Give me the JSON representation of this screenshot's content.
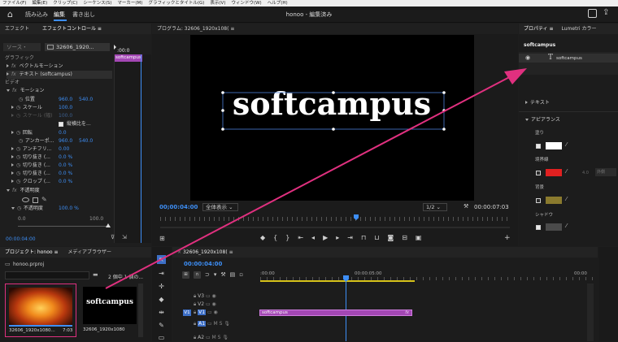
{
  "menu": [
    "ファイル(F)",
    "編集(E)",
    "クリップ(C)",
    "シーケンス(S)",
    "マーカー(M)",
    "グラフィックとタイトル(G)",
    "表示(V)",
    "ウィンドウ(W)",
    "ヘルプ(H)"
  ],
  "topbar": {
    "tabs": [
      "読み込み",
      "編集",
      "書き出し"
    ],
    "active_tab": "編集",
    "project_title": "honoo - 編集済み"
  },
  "effect_panel": {
    "tabs": [
      "エフェクト",
      "エフェクトコントロール ≡"
    ],
    "source_tab": "ソース・",
    "clip_tab": "32606_1920...",
    "clip_name": "softcampus",
    "timecode_start": ":00:0",
    "section_graphic": "グラフィック",
    "vector_motion": "ベクトルモーション",
    "text_item": "テキスト (softcampus)",
    "section_video": "ビデオ",
    "motion": "モーション",
    "props": [
      {
        "label": "位置",
        "v1": "960.0",
        "v2": "540.0"
      },
      {
        "label": "スケール",
        "v1": "100.0",
        "v2": ""
      },
      {
        "label": "スケール (幅)",
        "v1": "100.0",
        "v2": ""
      }
    ],
    "uniform_scale": "縦横比を...",
    "props2": [
      {
        "label": "回転",
        "v1": "0.0",
        "v2": ""
      },
      {
        "label": "アンカーポ...",
        "v1": "960.0",
        "v2": "540.0"
      },
      {
        "label": "アンチフリ...",
        "v1": "0.00",
        "v2": ""
      },
      {
        "label": "切り抜き (...",
        "v1": "0.0 %",
        "v2": ""
      },
      {
        "label": "切り抜き (...",
        "v1": "0.0 %",
        "v2": ""
      },
      {
        "label": "切り抜き (...",
        "v1": "0.0 %",
        "v2": ""
      },
      {
        "label": "クロップ (...",
        "v1": "0.0 %",
        "v2": ""
      }
    ],
    "opacity_section": "不透明度",
    "opacity_label": "不透明度",
    "opacity_value": "100.0 %",
    "slider_min": "0.0",
    "slider_max": "100.0",
    "timecode_bottom": "00:00:04:00"
  },
  "program": {
    "title": "プログラム: 32606_1920x108( ≡",
    "overlay_text": "softcampus",
    "timecode": "00;00:04:00",
    "fit": "全体表示",
    "quality": "1/2",
    "duration": "00:00:07:03"
  },
  "properties": {
    "tabs": [
      "プロパティ ≡",
      "Lumetri カラー"
    ],
    "clip_name": "softcampus",
    "layer_name": "softcampus",
    "text_section": "テキスト",
    "appearance_section": "アピアランス",
    "fill_label": "塗り",
    "stroke_label": "境界線",
    "stroke_width": "4.0",
    "stroke_mode": "外側",
    "background_label": "背景",
    "shadow_label": "シャドウ",
    "fill_color": "#ffffff",
    "stroke_color": "#e02020",
    "background_color": "#8a7a2e",
    "shadow_color": "#4a4a4a"
  },
  "project": {
    "tabs": [
      "プロジェクト: honoo ≡",
      "メディアブラウザー"
    ],
    "file": "honoo.prproj",
    "count": "2 個中 1 個の...",
    "items": [
      {
        "name": "32606_1920x1080...",
        "duration": "7:03"
      },
      {
        "name": "32606_1920x1080",
        "duration": ""
      }
    ]
  },
  "timeline": {
    "title": "32606_1920x108(",
    "timecode": "00:00:04:00",
    "ruler": [
      ":00:00",
      "00:00:05:00",
      "00:00"
    ],
    "tracks": [
      "V3",
      "V2",
      "V1",
      "A1",
      "A2"
    ],
    "clip_label": "softcampus",
    "clip_fx": "fx"
  }
}
